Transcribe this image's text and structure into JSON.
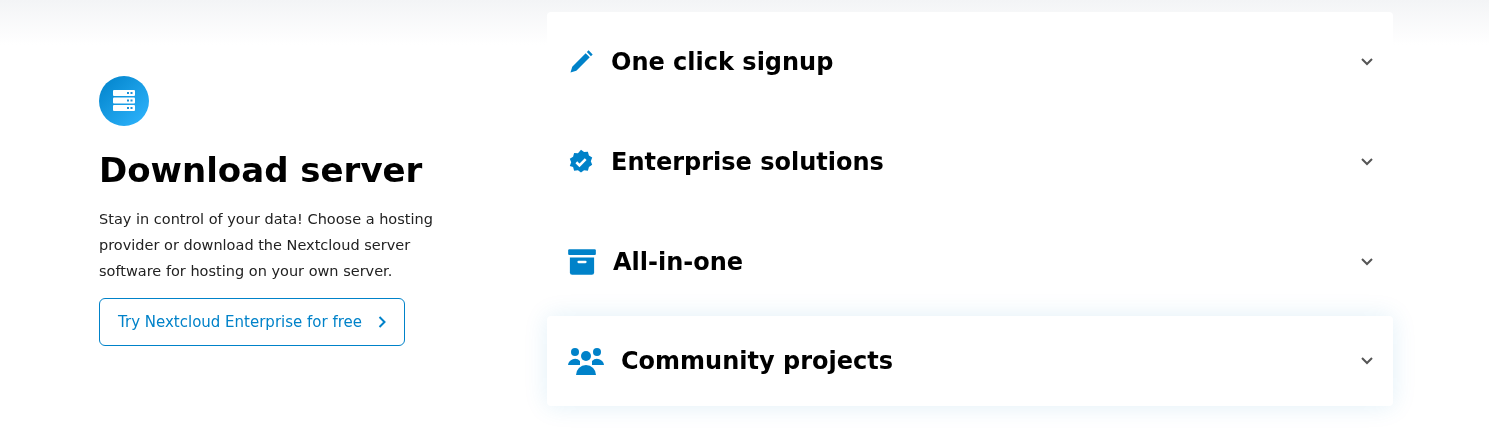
{
  "download": {
    "title": "Download server",
    "description": "Stay in control of your data! Choose a hosting provider or download the Nextcloud server software for hosting on your own server.",
    "button": {
      "label": "Try Nextcloud Enterprise for free"
    }
  },
  "accordion": [
    {
      "title": "One click signup",
      "selected": false,
      "expanded": false
    },
    {
      "title": "Enterprise solutions",
      "selected": false,
      "expanded": false
    },
    {
      "title": "All-in-one",
      "selected": false,
      "expanded": false
    },
    {
      "title": "Community projects",
      "selected": true,
      "expanded": false
    }
  ]
}
